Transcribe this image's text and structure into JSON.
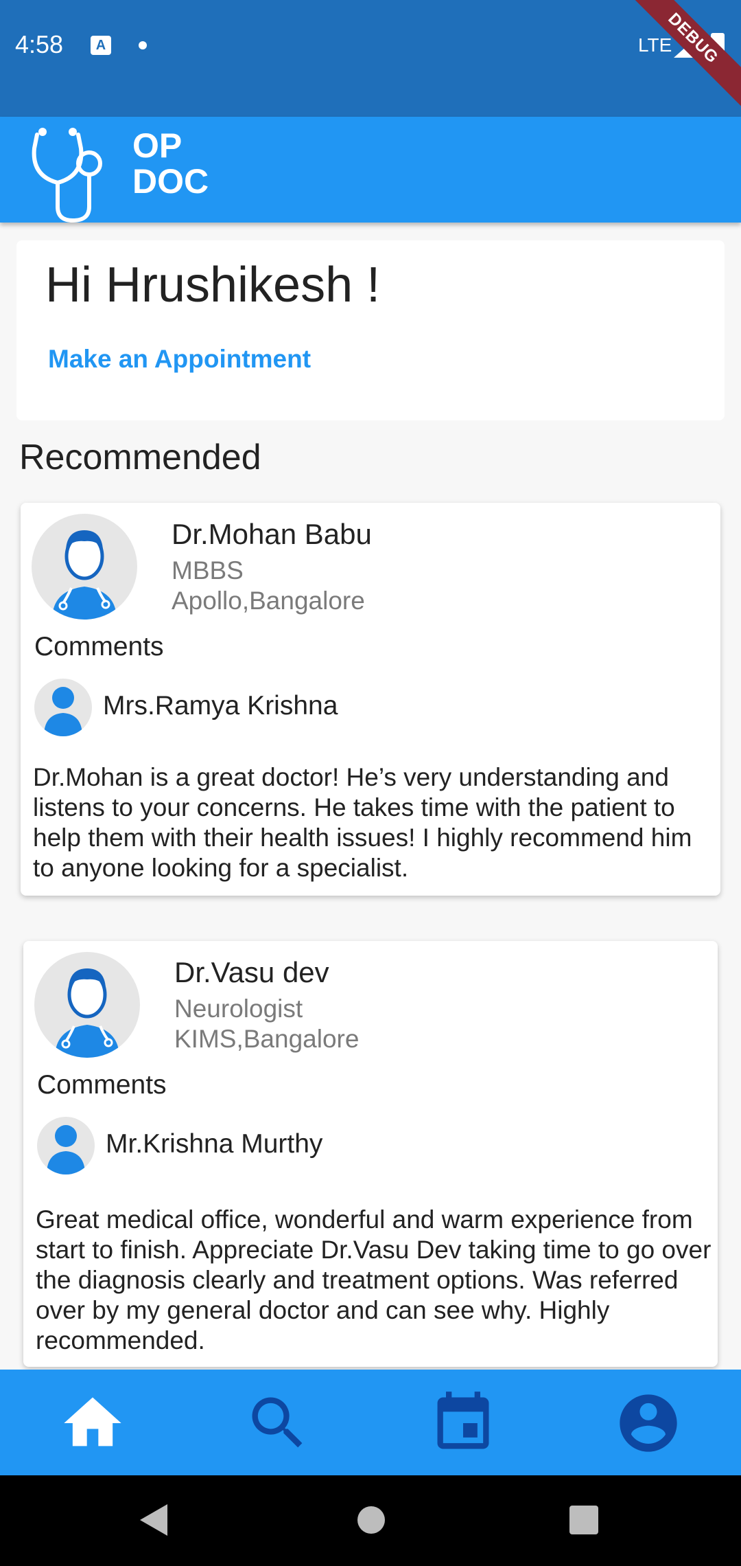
{
  "status_bar": {
    "time": "4:58",
    "network": "LTE",
    "debug_label": "DEBUG"
  },
  "app_bar": {
    "logo_line1": "OP",
    "logo_line2": "DOC"
  },
  "greeting": {
    "title": "Hi Hrushikesh !",
    "link": "Make an Appointment"
  },
  "section_title": "Recommended",
  "doctors": [
    {
      "name": "Dr.Mohan Babu",
      "qualification": "MBBS",
      "location": "Apollo,Bangalore",
      "comments_label": "Comments",
      "commenter": "Mrs.Ramya Krishna",
      "comment": "Dr.Mohan is a great doctor! He’s very understanding and listens to your concerns. He takes time with the patient to help them with their health issues! I highly recommend him to anyone looking for a specialist."
    },
    {
      "name": "Dr.Vasu dev",
      "qualification": "Neurologist",
      "location": "KIMS,Bangalore",
      "comments_label": "Comments",
      "commenter": "Mr.Krishna Murthy",
      "comment": "Great medical office, wonderful and warm experience from start to finish. Appreciate Dr.Vasu Dev taking time to go over the diagnosis clearly and treatment options. Was referred over by my general doctor and can see why. Highly recommended."
    }
  ],
  "bottom_nav": {
    "items": [
      "home-icon",
      "search-icon",
      "calendar-icon",
      "account-icon"
    ],
    "active": "home-icon"
  },
  "colors": {
    "primary": "#2196f3",
    "status_bar": "#1f6fba",
    "active_icon": "#ffffff",
    "inactive_icon": "#0d47a1"
  }
}
